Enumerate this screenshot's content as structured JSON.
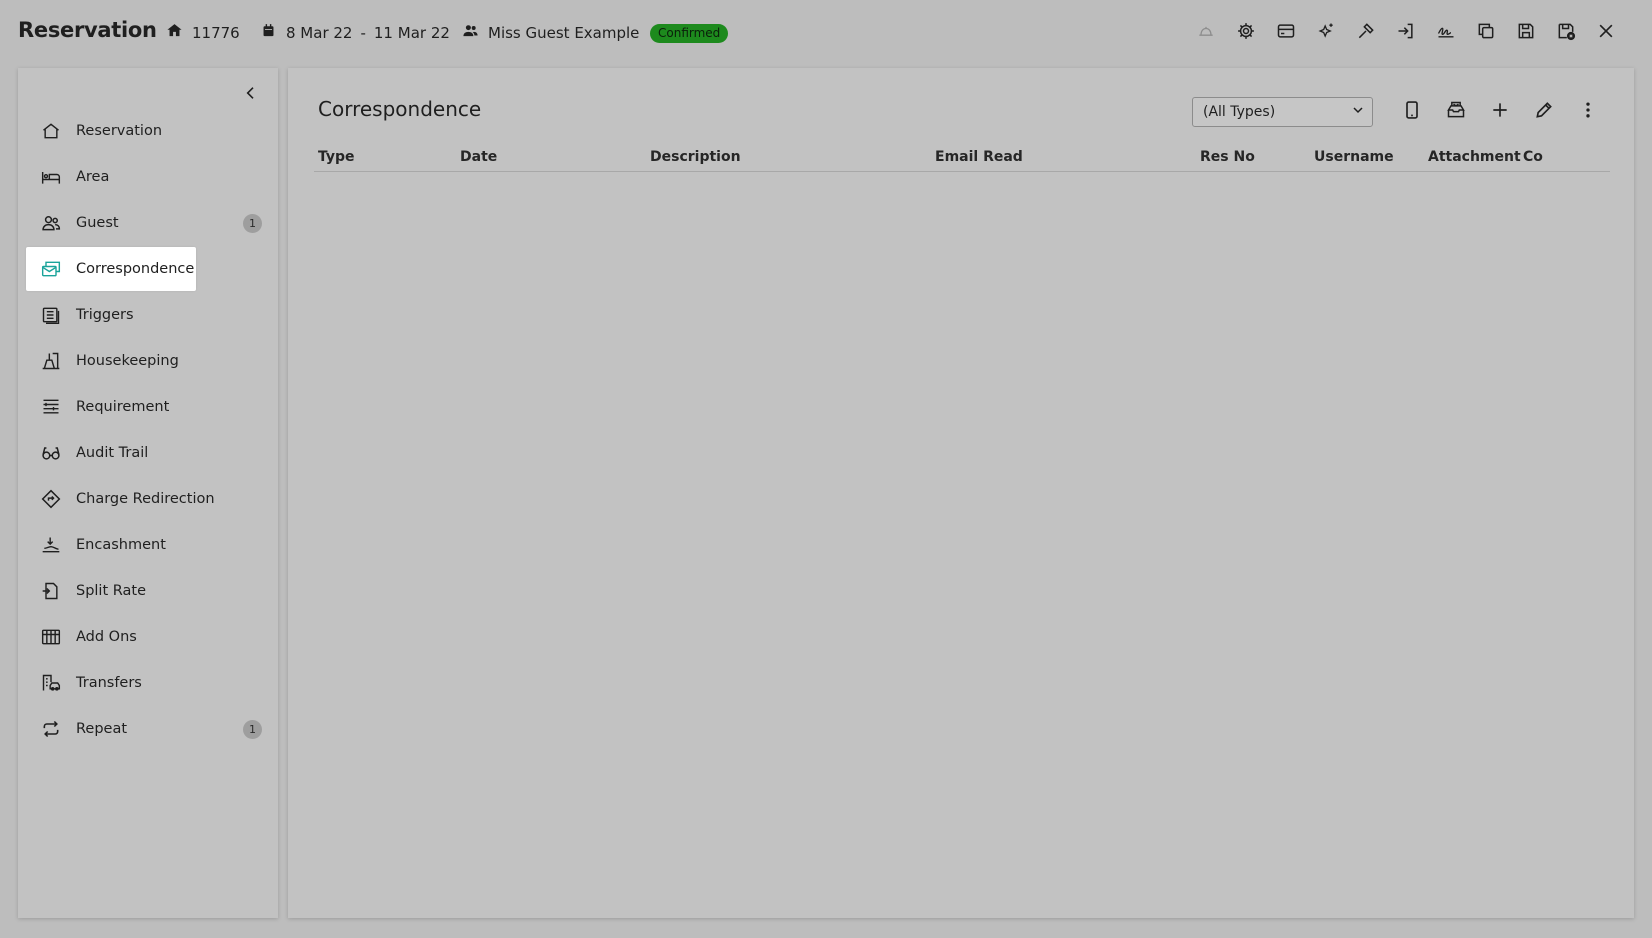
{
  "header": {
    "title": "Reservation",
    "reservation_no": "11776",
    "date_from": "8 Mar 22",
    "date_sep": "-",
    "date_to": "11 Mar 22",
    "guest_name": "Miss Guest Example",
    "status": "Confirmed",
    "status_color": "#1d8a1d",
    "actions": [
      {
        "icon": "bell-icon",
        "enabled": false
      },
      {
        "icon": "gear-icon",
        "enabled": true
      },
      {
        "icon": "credit-card-icon",
        "enabled": true
      },
      {
        "icon": "sparkle-icon",
        "enabled": true
      },
      {
        "icon": "hammer-icon",
        "enabled": true
      },
      {
        "icon": "sign-in-icon",
        "enabled": true
      },
      {
        "icon": "signature-icon",
        "enabled": true
      },
      {
        "icon": "copy-icon",
        "enabled": true
      },
      {
        "icon": "save-icon",
        "enabled": true
      },
      {
        "icon": "save-close-icon",
        "enabled": true
      },
      {
        "icon": "close-icon",
        "enabled": true
      }
    ]
  },
  "sidebar": {
    "items": [
      {
        "label": "Reservation",
        "icon": "home-icon"
      },
      {
        "label": "Area",
        "icon": "bed-icon"
      },
      {
        "label": "Guest",
        "icon": "guests-icon",
        "count": "1"
      },
      {
        "label": "Correspondence",
        "icon": "correspondence-icon",
        "active": true
      },
      {
        "label": "Triggers",
        "icon": "triggers-icon"
      },
      {
        "label": "Housekeeping",
        "icon": "housekeeping-icon"
      },
      {
        "label": "Requirement",
        "icon": "requirement-icon"
      },
      {
        "label": "Audit Trail",
        "icon": "glasses-icon"
      },
      {
        "label": "Charge Redirection",
        "icon": "redirect-icon"
      },
      {
        "label": "Encashment",
        "icon": "encashment-icon"
      },
      {
        "label": "Split Rate",
        "icon": "split-rate-icon"
      },
      {
        "label": "Add Ons",
        "icon": "add-ons-icon"
      },
      {
        "label": "Transfers",
        "icon": "transfers-icon"
      },
      {
        "label": "Repeat",
        "icon": "repeat-icon",
        "count": "1"
      }
    ]
  },
  "main": {
    "title": "Correspondence",
    "filter_selected": "(All Types)",
    "actions": [
      "mobile-icon",
      "mail-tray-icon",
      "plus-icon",
      "pencil-icon",
      "more-vertical-icon"
    ],
    "columns": [
      "Type",
      "Date",
      "Description",
      "Email Read",
      "Res No",
      "Username",
      "Attachment",
      "Co"
    ]
  },
  "colors": {
    "background": "#bdbdbd",
    "panel": "#c2c2c2",
    "active_item": "#ffffff",
    "accent": "#1aa39a"
  }
}
